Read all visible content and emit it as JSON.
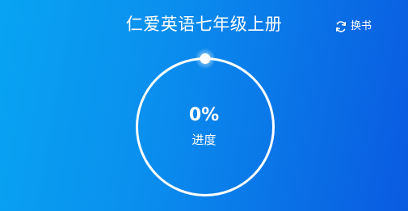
{
  "header": {
    "title": "仁爱英语七年级上册",
    "switch_label": "换书",
    "switch_icon": "refresh-icon"
  },
  "progress": {
    "value_text": "0%",
    "value": 0,
    "label": "进度"
  },
  "colors": {
    "background_start": "#08a4f2",
    "background_end": "#0a5be0",
    "ring": "#ffffff",
    "text": "#ffffff"
  }
}
